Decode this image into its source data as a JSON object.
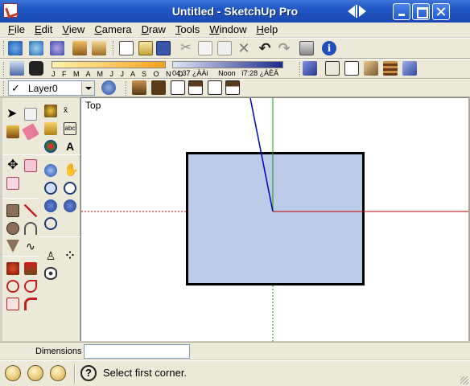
{
  "window": {
    "title": "Untitled - SketchUp Pro"
  },
  "menu": [
    {
      "label": "File",
      "key": "F",
      "rest": "ile"
    },
    {
      "label": "Edit",
      "key": "E",
      "rest": "dit"
    },
    {
      "label": "View",
      "key": "V",
      "rest": "iew"
    },
    {
      "label": "Camera",
      "key": "C",
      "rest": "amera"
    },
    {
      "label": "Draw",
      "key": "D",
      "rest": "raw"
    },
    {
      "label": "Tools",
      "key": "T",
      "rest": "ools"
    },
    {
      "label": "Window",
      "key": "W",
      "rest": "indow"
    },
    {
      "label": "Help",
      "key": "H",
      "rest": "elp"
    }
  ],
  "shadow": {
    "months": "J F M A M J J A S O N D",
    "time_start": "04:37",
    "time_start_suffix": "¿ÀÀi",
    "time_mid": "Noon",
    "time_end": "ï7:28",
    "time_end_suffix": "¿ÀÈÄ"
  },
  "layers": {
    "current": "Layer0"
  },
  "viewport": {
    "view_name": "Top"
  },
  "measurements": {
    "label": "Dimensions",
    "value": ""
  },
  "status": {
    "message": "Select first corner.",
    "help_glyph": "?"
  },
  "colors": {
    "rectangle_fill": "#bccbe8",
    "axis_red": "#c00000",
    "axis_green": "#00a000",
    "axis_blue": "#0000c0",
    "title_bar": "#2055c4"
  }
}
